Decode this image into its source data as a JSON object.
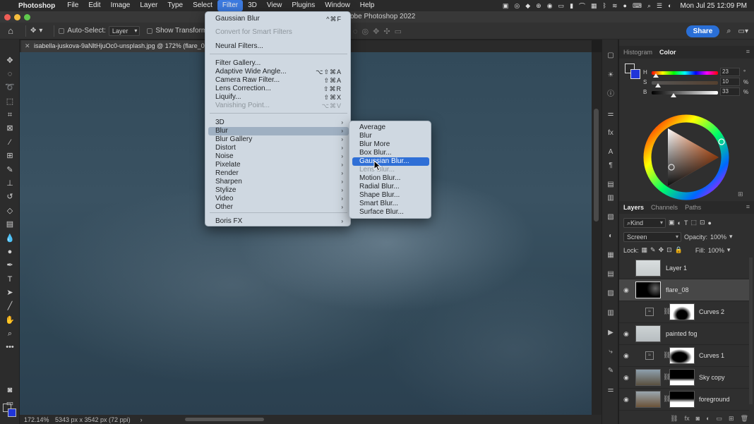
{
  "menubar": {
    "app_name": "Photoshop",
    "items": [
      "File",
      "Edit",
      "Image",
      "Layer",
      "Type",
      "Select",
      "Filter",
      "3D",
      "View",
      "Plugins",
      "Window",
      "Help"
    ],
    "active": "Filter",
    "clock": "Mon Jul 25  12:09 PM"
  },
  "window": {
    "title": "obe Photoshop 2022"
  },
  "options": {
    "auto_select_label": "Auto-Select:",
    "auto_select_value": "Layer",
    "transform_label": "Show Transform Controls",
    "share_label": "Share"
  },
  "document": {
    "tab_title": "isabella-juskova-9aNltHjuOc0-unsplash.jpg @ 172% (flare_08, R",
    "zoom": "172.14%",
    "doc_info": "5343 px x 3542 px (72 ppi)"
  },
  "filter_menu": {
    "top_item": {
      "label": "Gaussian Blur",
      "shortcut": "^⌘F"
    },
    "convert": "Convert for Smart Filters",
    "neural": "Neural Filters...",
    "group1": [
      {
        "label": "Filter Gallery...",
        "shortcut": "",
        "disabled": false
      },
      {
        "label": "Adaptive Wide Angle...",
        "shortcut": "⌥⇧⌘A",
        "disabled": false
      },
      {
        "label": "Camera Raw Filter...",
        "shortcut": "⇧⌘A",
        "disabled": false
      },
      {
        "label": "Lens Correction...",
        "shortcut": "⇧⌘R",
        "disabled": false
      },
      {
        "label": "Liquify...",
        "shortcut": "⇧⌘X",
        "disabled": false
      },
      {
        "label": "Vanishing Point...",
        "shortcut": "⌥⌘V",
        "disabled": true
      }
    ],
    "submenus": [
      "3D",
      "Blur",
      "Blur Gallery",
      "Distort",
      "Noise",
      "Pixelate",
      "Render",
      "Sharpen",
      "Stylize",
      "Video",
      "Other"
    ],
    "highlighted_submenu": "Blur",
    "boris": "Boris FX"
  },
  "blur_menu": {
    "items": [
      {
        "label": "Average",
        "disabled": false
      },
      {
        "label": "Blur",
        "disabled": false
      },
      {
        "label": "Blur More",
        "disabled": false
      },
      {
        "label": "Box Blur...",
        "disabled": false
      },
      {
        "label": "Gaussian Blur...",
        "disabled": false
      },
      {
        "label": "Lens Blur...",
        "disabled": true
      },
      {
        "label": "Motion Blur...",
        "disabled": false
      },
      {
        "label": "Radial Blur...",
        "disabled": false
      },
      {
        "label": "Shape Blur...",
        "disabled": false
      },
      {
        "label": "Smart Blur...",
        "disabled": false
      },
      {
        "label": "Surface Blur...",
        "disabled": false
      }
    ],
    "highlighted": "Gaussian Blur..."
  },
  "color_panel": {
    "tabs": [
      "Histogram",
      "Color"
    ],
    "active_tab": "Color",
    "h": {
      "letter": "H",
      "value": "23",
      "unit": "°",
      "level": 0.064
    },
    "s": {
      "letter": "S",
      "value": "10",
      "unit": "%",
      "level": 0.1
    },
    "b": {
      "letter": "B",
      "value": "33",
      "unit": "%",
      "level": 0.33
    },
    "bg_color": "#2035d8"
  },
  "layers_panel": {
    "tabs": [
      "Layers",
      "Channels",
      "Paths"
    ],
    "active_tab": "Layers",
    "kind_label": "Kind",
    "blend_mode": "Screen",
    "opacity_label": "Opacity:",
    "opacity_value": "100%",
    "lock_label": "Lock:",
    "fill_label": "Fill:",
    "fill_value": "100%",
    "layers": [
      {
        "name": "Layer 1",
        "visible": false,
        "selected": false,
        "type": "pixel"
      },
      {
        "name": "flare_08",
        "visible": true,
        "selected": true,
        "type": "pixel"
      },
      {
        "name": "Curves 2",
        "visible": true,
        "selected": false,
        "type": "adjustment"
      },
      {
        "name": "painted fog",
        "visible": true,
        "selected": false,
        "type": "pixel"
      },
      {
        "name": "Curves 1",
        "visible": true,
        "selected": false,
        "type": "adjustment"
      },
      {
        "name": "Sky copy",
        "visible": true,
        "selected": false,
        "type": "masked"
      },
      {
        "name": "foreground",
        "visible": true,
        "selected": false,
        "type": "masked"
      }
    ]
  },
  "colors": {
    "accent": "#2f6fd6",
    "menu_bg": "#cfd8e1"
  }
}
